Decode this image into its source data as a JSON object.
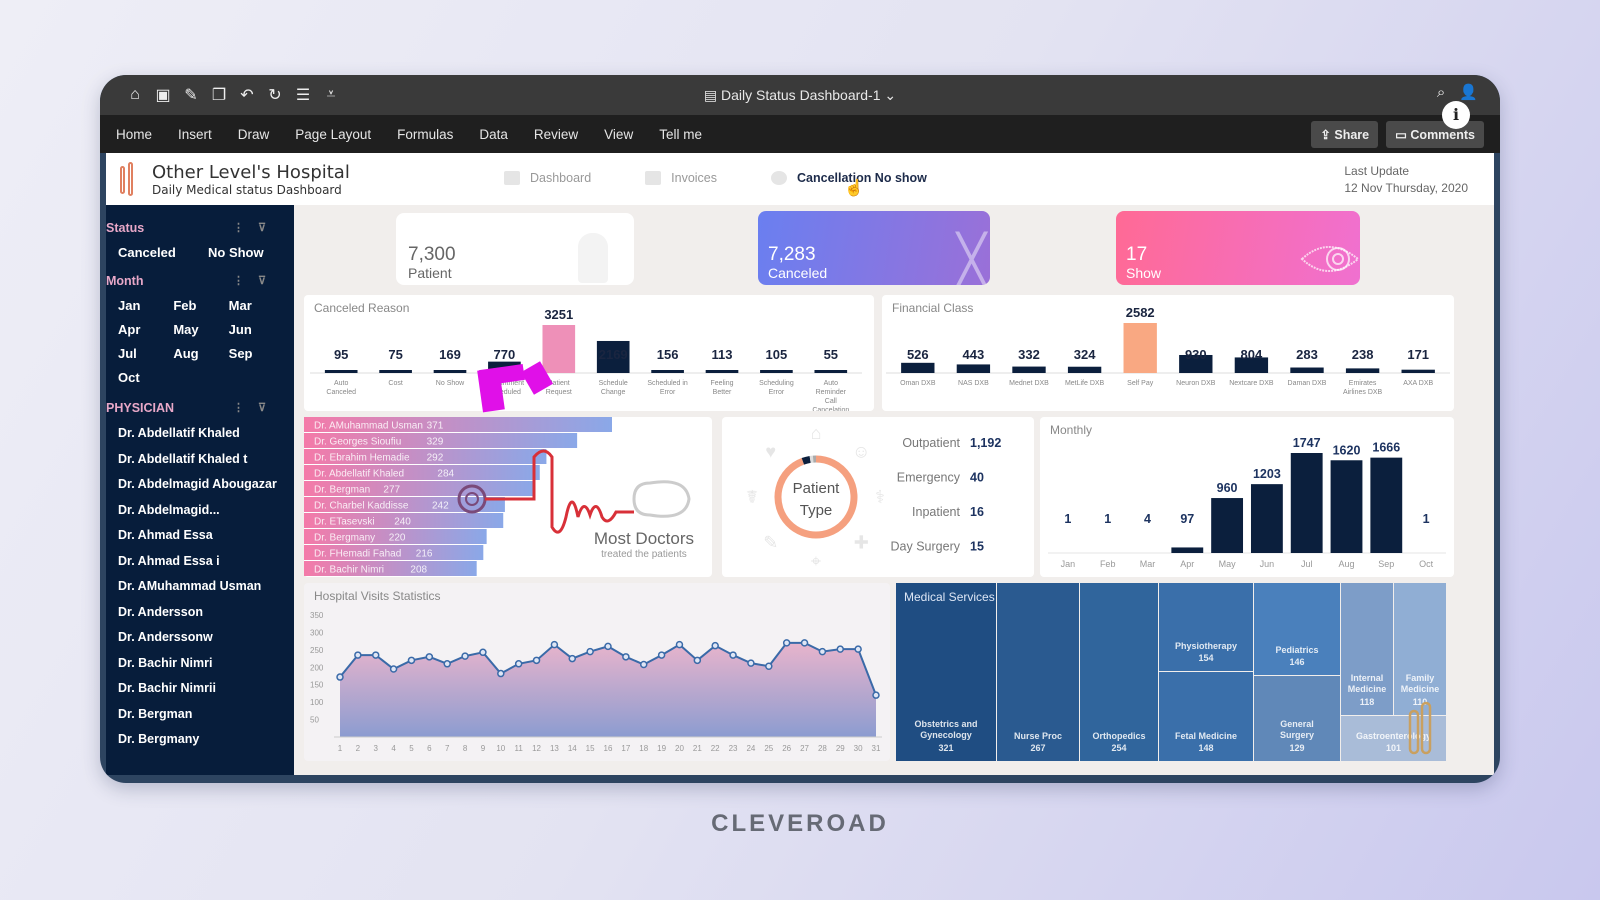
{
  "window": {
    "title": "Daily Status Dashboard-1",
    "toolbar_icons": [
      "home-icon",
      "save-icon",
      "edit-icon",
      "clipboard-icon",
      "undo-icon",
      "redo-icon",
      "align-icon",
      "customize-icon"
    ],
    "menu": [
      "Home",
      "Insert",
      "Draw",
      "Page Layout",
      "Formulas",
      "Data",
      "Review",
      "View",
      "Tell me"
    ],
    "share_label": "Share",
    "comments_label": "Comments"
  },
  "header": {
    "hospital_name": "Other Level's Hospital",
    "subtitle": "Daily Medical status Dashboard",
    "tabs": [
      {
        "label": "Dashboard",
        "active": false
      },
      {
        "label": "Invoices",
        "active": false
      },
      {
        "label": "Cancellation No show",
        "active": true
      }
    ],
    "last_update_label": "Last Update",
    "last_update_value": "12 Nov Thursday, 2020"
  },
  "sidebar": {
    "status_title": "Status",
    "status_items": [
      "Canceled",
      "No Show"
    ],
    "month_title": "Month",
    "month_items": [
      "Jan",
      "Feb",
      "Mar",
      "Apr",
      "May",
      "Jun",
      "Jul",
      "Aug",
      "Sep",
      "Oct"
    ],
    "physician_title": "PHYSICIAN",
    "physicians": [
      "Dr. Abdellatif Khaled",
      "Dr. Abdellatif Khaled t",
      "Dr. Abdelmagid Abougazar",
      "Dr. Abdelmagid...",
      "Dr. Ahmad Essa",
      "Dr. Ahmad Essa i",
      "Dr. AMuhammad Usman",
      "Dr. Andersson",
      "Dr. Anderssonw",
      "Dr. Bachir Nimri",
      "Dr. Bachir Nimrii",
      "Dr. Bergman",
      "Dr. Bergmany"
    ]
  },
  "kpis": {
    "patient": {
      "value": "7,300",
      "label": "Patient"
    },
    "canceled": {
      "value": "7,283",
      "label": "Canceled",
      "color_from": "#6a7ff0",
      "color_to": "#9a70d8"
    },
    "show": {
      "value": "17",
      "label": "Show",
      "color_from": "#ff6a95",
      "color_to": "#f070d0"
    }
  },
  "canceled_reason": {
    "title": "Canceled Reason",
    "categories": [
      "Auto Canceled",
      "Cost",
      "No Show",
      "Appointment Scheduled",
      "Patient Request",
      "Schedule Change",
      "Scheduled in Error",
      "Feeling Better",
      "Scheduling Error",
      "Auto Reminder Call Cancelation"
    ],
    "values": [
      95,
      75,
      169,
      770,
      3251,
      2169,
      156,
      113,
      105,
      55
    ],
    "highlight_index": 4,
    "highlight_color": "#ee90b8",
    "bar_color": "#0b1f3d"
  },
  "financial_class": {
    "title": "Financial Class",
    "categories": [
      "Oman DXB",
      "NAS DXB",
      "Mednet DXB",
      "MetLife DXB",
      "Self Pay",
      "Neuron DXB",
      "Nextcare DXB",
      "Daman DXB",
      "Emirates Airlines DXB",
      "AXA DXB"
    ],
    "values": [
      526,
      443,
      332,
      324,
      2582,
      930,
      804,
      283,
      238,
      171
    ],
    "highlight_index": 4,
    "highlight_color": "#f9a882",
    "bar_color": "#0b1f3d"
  },
  "most_doctors": {
    "title": "Most Doctors",
    "subtitle": "treated the patients",
    "doctors": [
      {
        "name": "Dr. AMuhammad Usman",
        "value": 371
      },
      {
        "name": "Dr. Georges Sioufiu",
        "value": 329
      },
      {
        "name": "Dr. Ebrahim Hemadie",
        "value": 292
      },
      {
        "name": "Dr. Abdellatif Khaled",
        "value": 284
      },
      {
        "name": "Dr. Bergman",
        "value": 277
      },
      {
        "name": "Dr. Charbel Kaddisse",
        "value": 242
      },
      {
        "name": "Dr. ETasevski",
        "value": 240
      },
      {
        "name": "Dr. Bergmany",
        "value": 220
      },
      {
        "name": "Dr. FHemadi Fahad",
        "value": 216
      },
      {
        "name": "Dr. Bachir Nimri",
        "value": 208
      }
    ]
  },
  "patient_type": {
    "title_line1": "Patient",
    "title_line2": "Type",
    "items": [
      {
        "label": "Outpatient",
        "value": "1,192",
        "num": 1192
      },
      {
        "label": "Emergency",
        "value": "40",
        "num": 40
      },
      {
        "label": "Inpatient",
        "value": "16",
        "num": 16
      },
      {
        "label": "Day Surgery",
        "value": "15",
        "num": 15
      }
    ],
    "ring_color": "#f5a07f"
  },
  "monthly": {
    "title": "Monthly",
    "categories": [
      "Jan",
      "Feb",
      "Mar",
      "Apr",
      "May",
      "Jun",
      "Jul",
      "Aug",
      "Sep",
      "Oct"
    ],
    "values": [
      1,
      1,
      4,
      97,
      960,
      1203,
      1747,
      1620,
      1666,
      1
    ],
    "bar_color": "#0b1f3d"
  },
  "chart_data": {
    "type": "area",
    "title": "Hospital Visits Statistics",
    "x": [
      1,
      2,
      3,
      4,
      5,
      6,
      7,
      8,
      9,
      10,
      11,
      12,
      13,
      14,
      15,
      16,
      17,
      18,
      19,
      20,
      21,
      22,
      23,
      24,
      25,
      26,
      27,
      28,
      29,
      30,
      31
    ],
    "values": [
      172,
      235,
      235,
      195,
      220,
      230,
      210,
      232,
      243,
      182,
      210,
      220,
      265,
      225,
      245,
      260,
      230,
      208,
      235,
      265,
      220,
      262,
      235,
      212,
      203,
      270,
      270,
      245,
      252,
      252,
      120
    ],
    "ylim": [
      0,
      350
    ],
    "yticks": [
      0,
      50,
      100,
      150,
      200,
      250,
      300,
      350
    ],
    "xlabel": "",
    "ylabel": "",
    "grid": false
  },
  "medical_services": {
    "title": "Medical Services",
    "items": [
      {
        "label": "Obstetrics and Gynecology",
        "value": 321
      },
      {
        "label": "Nurse Proc",
        "value": 267
      },
      {
        "label": "Orthopedics",
        "value": 254
      },
      {
        "label": "Physiotherapy",
        "value": 154
      },
      {
        "label": "Fetal Medicine",
        "value": 148
      },
      {
        "label": "Pediatrics",
        "value": 146
      },
      {
        "label": "General Surgery",
        "value": 129
      },
      {
        "label": "Internal Medicine",
        "value": 118
      },
      {
        "label": "Family Medicine",
        "value": 110
      },
      {
        "label": "Gastroenterology",
        "value": 101
      }
    ]
  },
  "footer": {
    "brand": "CLEVEROAD"
  }
}
